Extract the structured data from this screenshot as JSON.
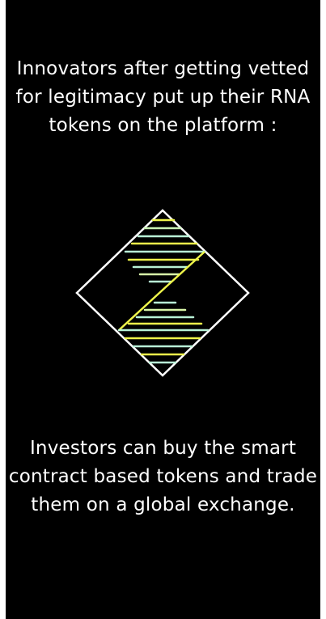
{
  "intro": {
    "text": "Innovators after getting vetted for legitimacy put up their RNA tokens on the platform :"
  },
  "logo": {
    "icon": "diamond-z-logo-icon",
    "colors": {
      "outline": "#ffffff",
      "stripe_light": "#b8f2d6",
      "stripe_mid": "#d8f5a8",
      "stripe_yellow": "#eef44a"
    }
  },
  "outro": {
    "text": "Investors can buy the smart contract based  tokens and trade them on a global exchange."
  }
}
